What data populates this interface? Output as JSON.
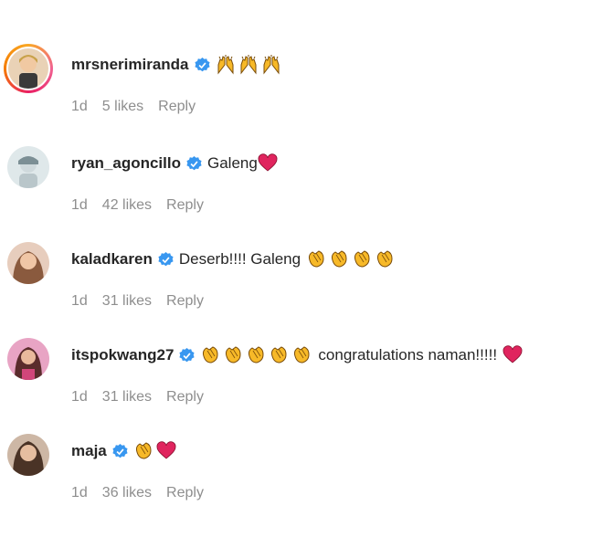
{
  "comments": [
    {
      "username": "mrsnerimiranda",
      "verified": true,
      "text": "",
      "emojis_before_text": [
        "raised-hands-icon",
        "raised-hands-icon",
        "raised-hands-icon"
      ],
      "emojis_after_text": [],
      "time": "1d",
      "likes": "5 likes",
      "reply": "Reply",
      "avatar": "avatar-mrsnerimiranda",
      "has_story_ring": true
    },
    {
      "username": "ryan_agoncillo",
      "verified": true,
      "text": "Galeng",
      "emojis_before_text": [],
      "emojis_after_text": [
        "red-heart-icon"
      ],
      "time": "1d",
      "likes": "42 likes",
      "reply": "Reply",
      "avatar": "avatar-ryan_agoncillo",
      "has_story_ring": false
    },
    {
      "username": "kaladkaren",
      "verified": true,
      "text": "Deserb!!!! Galeng",
      "emojis_before_text": [],
      "emojis_after_text": [
        "clapping-hands-icon",
        "clapping-hands-icon",
        "clapping-hands-icon",
        "clapping-hands-icon"
      ],
      "time": "1d",
      "likes": "31 likes",
      "reply": "Reply",
      "avatar": "avatar-kaladkaren",
      "has_story_ring": false
    },
    {
      "username": "itspokwang27",
      "verified": true,
      "text": "congratulations naman!!!!!",
      "emojis_before_text": [
        "clapping-hands-icon",
        "clapping-hands-icon",
        "clapping-hands-icon",
        "clapping-hands-icon",
        "clapping-hands-icon"
      ],
      "emojis_after_text": [
        "red-heart-icon"
      ],
      "time": "1d",
      "likes": "31 likes",
      "reply": "Reply",
      "avatar": "avatar-itspokwang27",
      "has_story_ring": false
    },
    {
      "username": "maja",
      "verified": true,
      "text": "",
      "emojis_before_text": [
        "clapping-hands-icon",
        "red-heart-icon"
      ],
      "emojis_after_text": [],
      "time": "1d",
      "likes": "36 likes",
      "reply": "Reply",
      "avatar": "avatar-maja",
      "has_story_ring": false
    }
  ],
  "colors": {
    "verified_blue": "#3897f0",
    "text": "#262626",
    "muted": "#8e8e8e",
    "heart_red": "#e0245e",
    "emoji_yellow": "#f7b928"
  }
}
